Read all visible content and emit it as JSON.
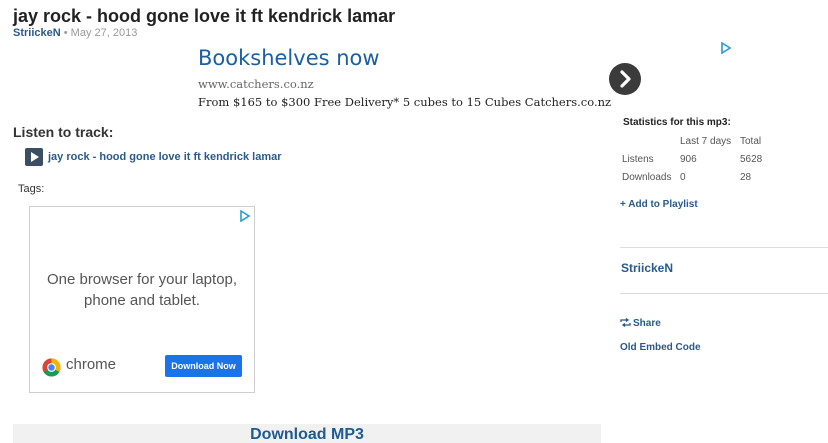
{
  "page": {
    "title": "jay rock - hood gone love it ft kendrick lamar",
    "author": "StriickeN",
    "date": "• May 27, 2013"
  },
  "ad_top": {
    "headline": "Bookshelves now",
    "url": "www.catchers.co.nz",
    "description": "From $165 to $300 Free Delivery* 5 cubes to 15 Cubes Catchers.co.nz"
  },
  "listen": {
    "heading": "Listen to track:",
    "track": "jay rock - hood gone love it ft kendrick lamar"
  },
  "tags": {
    "label": "Tags:"
  },
  "ad_box": {
    "line1": "One browser for your laptop,",
    "line2": "phone and tablet.",
    "brand": "chrome",
    "cta": "Download Now"
  },
  "download": {
    "label": "Download MP3"
  },
  "sidebar": {
    "stats_title": "Statistics for this mp3:",
    "col_week": "Last 7 days",
    "col_total": "Total",
    "rows": [
      {
        "label": "Listens",
        "week": "906",
        "total": "5628"
      },
      {
        "label": "Downloads",
        "week": "0",
        "total": "28"
      }
    ],
    "add_playlist": "+ Add to Playlist",
    "author": "StriickeN",
    "share": "Share",
    "embed": "Old Embed Code"
  },
  "colors": {
    "link": "#2a5a8a",
    "ad_headline": "#1a5fa3",
    "chrome_cta": "#1a73e8"
  }
}
